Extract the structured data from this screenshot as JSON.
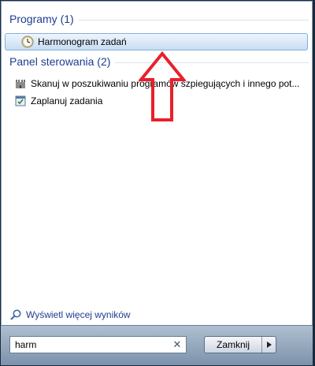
{
  "programs": {
    "header": "Programy (1)",
    "items": [
      {
        "label": "Harmonogram zadań",
        "icon": "clock-icon"
      }
    ]
  },
  "control_panel": {
    "header": "Panel sterowania (2)",
    "items": [
      {
        "label": "Skanuj w poszukiwaniu programów szpiegujących i innego pot...",
        "icon": "defender-castle-icon"
      },
      {
        "label": "Zaplanuj zadania",
        "icon": "task-schedule-icon"
      }
    ]
  },
  "more_results": {
    "label": "Wyświetl więcej wyników",
    "icon": "search-icon"
  },
  "search": {
    "value": "harm"
  },
  "shutdown": {
    "label": "Zamknij"
  },
  "colors": {
    "header_text": "#1e3d8f",
    "annotation_arrow": "#e8202a"
  }
}
